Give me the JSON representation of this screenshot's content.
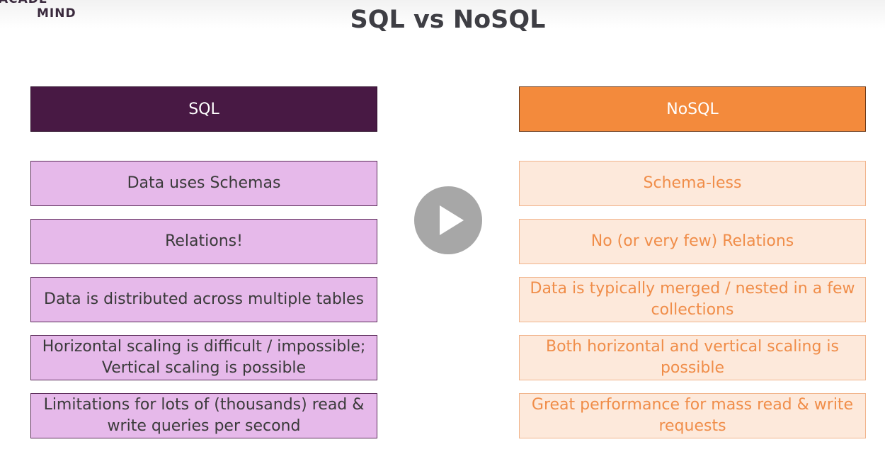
{
  "logo": {
    "line1": "ACADE",
    "line2": "MIND"
  },
  "title": "SQL vs NoSQL",
  "sql": {
    "header": "SQL",
    "items": [
      "Data uses Schemas",
      "Relations!",
      "Data is distributed across multiple tables",
      "Horizontal scaling is difficult / impossible; Vertical scaling is possible",
      "Limitations for lots of (thousands) read & write queries per second"
    ]
  },
  "nosql": {
    "header": "NoSQL",
    "items": [
      "Schema-less",
      "No (or very few) Relations",
      "Data is typically merged / nested in a few collections",
      "Both horizontal and vertical scaling is possible",
      "Great performance for mass read & write requests"
    ]
  },
  "player": {
    "icon": "play-icon"
  },
  "colors": {
    "sql_header": "#481944",
    "sql_box": "#e6b9ea",
    "nosql_header": "#f38a3c",
    "nosql_box": "#fde9db",
    "nosql_text": "#f08d49"
  }
}
